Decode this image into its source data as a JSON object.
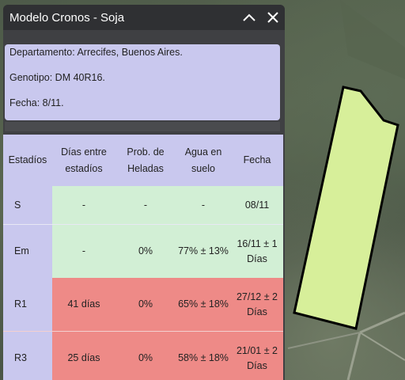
{
  "window": {
    "title": "Modelo Cronos - Soja"
  },
  "info": {
    "departamento": "Departamento: Arrecifes, Buenos Aires.",
    "genotipo": "Genotipo: DM 40R16.",
    "fecha": "Fecha: 8/11."
  },
  "table": {
    "headers": [
      "Estadíos",
      "Días entre estadíos",
      "Prob. de Heladas",
      "Agua en suelo",
      "Fecha"
    ],
    "rows": [
      {
        "stage": "S",
        "dias": "-",
        "heladas": "-",
        "agua": "-",
        "fecha": "08/11"
      },
      {
        "stage": "Em",
        "dias": "-",
        "heladas": "0%",
        "agua": "77% ± 13%",
        "fecha": "16/11 ± 1 Días"
      },
      {
        "stage": "R1",
        "dias": "41 días",
        "heladas": "0%",
        "agua": "65% ± 18%",
        "fecha": "27/12 ± 2 Días"
      },
      {
        "stage": "R3",
        "dias": "25 días",
        "heladas": "0%",
        "agua": "58% ± 18%",
        "fecha": "21/01 ± 2 Días"
      }
    ]
  },
  "icons": {
    "collapse": "chevron-up-icon",
    "close": "close-icon"
  },
  "colors": {
    "header_bg": "#c9c8ee",
    "ok_bg": "#d2efd5",
    "alert_bg": "#ee8a87",
    "field": "#d7ef9a"
  }
}
